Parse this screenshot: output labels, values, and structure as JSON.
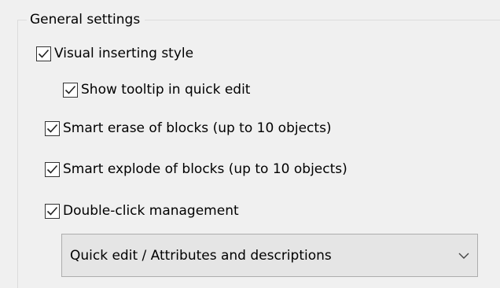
{
  "general_settings": {
    "title": "General settings",
    "options": [
      {
        "label": "Visual inserting style",
        "checked": true
      },
      {
        "label": "Show tooltip in quick edit",
        "checked": true
      },
      {
        "label": "Smart erase of blocks (up to 10 objects)",
        "checked": true
      },
      {
        "label": "Smart explode of blocks (up to 10 objects)",
        "checked": true
      },
      {
        "label": "Double-click management",
        "checked": true
      }
    ],
    "double_click_action": {
      "selected": "Quick edit / Attributes and descriptions"
    }
  },
  "icons": {
    "checkmark": "checkmark-icon",
    "dropdown": "chevron-down-icon"
  }
}
